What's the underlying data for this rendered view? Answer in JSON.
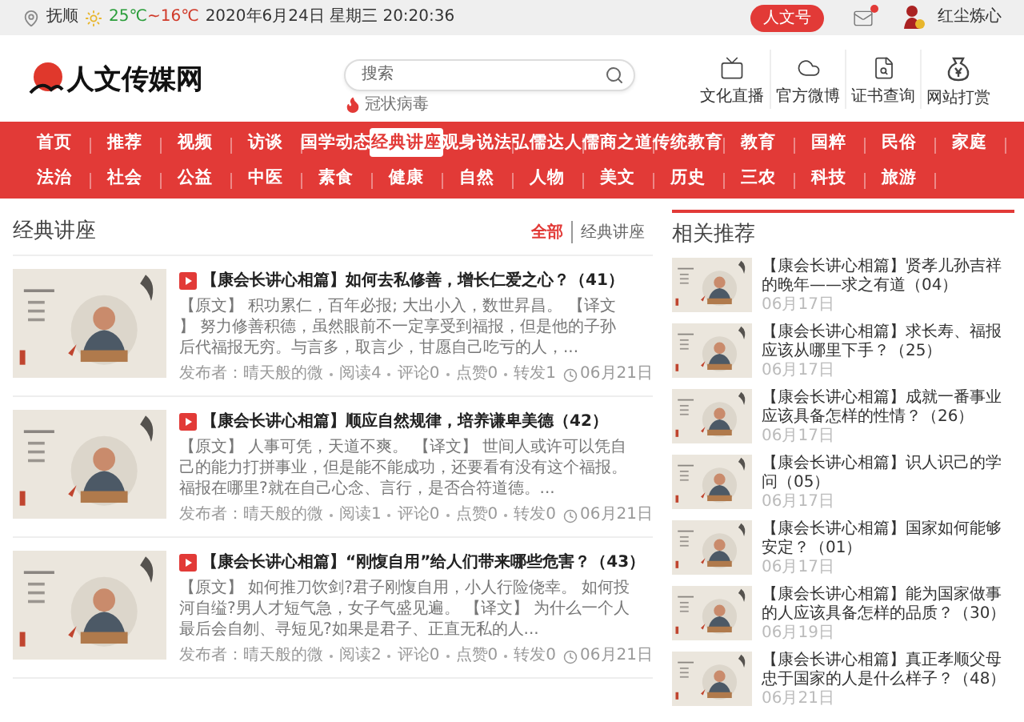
{
  "top_bar": {
    "city": "抚顺",
    "temp_high": "25℃",
    "temp_low": "~16℃",
    "datetime": "2020年6月24日 星期三 20:20:36",
    "account_button": "人文号",
    "mail": {
      "unread": true
    },
    "username": "红尘炼心"
  },
  "header": {
    "logo_text": "人文传媒网",
    "search": {
      "placeholder": "搜索"
    },
    "hot_tag": "冠状病毒",
    "shortcuts": [
      {
        "kind": "live",
        "label": "文化直播"
      },
      {
        "kind": "weibo",
        "label": "官方微博"
      },
      {
        "kind": "certificate",
        "label": "证书查询"
      },
      {
        "kind": "reward",
        "label": "网站打赏"
      }
    ]
  },
  "nav": {
    "rows": [
      [
        {
          "label": "首页",
          "selected": false
        },
        {
          "label": "推荐",
          "selected": false
        },
        {
          "label": "视频",
          "selected": false
        },
        {
          "label": "访谈",
          "selected": false
        },
        {
          "label": "国学动态",
          "selected": false
        },
        {
          "label": "经典讲座",
          "selected": true
        },
        {
          "label": "观身说法",
          "selected": false
        },
        {
          "label": "弘儒达人",
          "selected": false
        },
        {
          "label": "儒商之道",
          "selected": false
        },
        {
          "label": "传统教育",
          "selected": false
        },
        {
          "label": "教育",
          "selected": false
        },
        {
          "label": "国粹",
          "selected": false
        },
        {
          "label": "民俗",
          "selected": false
        },
        {
          "label": "家庭",
          "selected": false
        }
      ],
      [
        {
          "label": "法治",
          "selected": false
        },
        {
          "label": "社会",
          "selected": false
        },
        {
          "label": "公益",
          "selected": false
        },
        {
          "label": "中医",
          "selected": false
        },
        {
          "label": "素食",
          "selected": false
        },
        {
          "label": "健康",
          "selected": false
        },
        {
          "label": "自然",
          "selected": false
        },
        {
          "label": "人物",
          "selected": false
        },
        {
          "label": "美文",
          "selected": false
        },
        {
          "label": "历史",
          "selected": false
        },
        {
          "label": "三农",
          "selected": false
        },
        {
          "label": "科技",
          "selected": false
        },
        {
          "label": "旅游",
          "selected": false
        }
      ]
    ]
  },
  "section": {
    "title": "经典讲座",
    "filters": [
      {
        "label": "全部",
        "selected": true
      },
      {
        "label": "经典讲座",
        "selected": false
      }
    ]
  },
  "articles": [
    {
      "title": "【康会长讲心相篇】如何去私修善，增长仁爱之心？（41）",
      "excerpt": "【原文】 积功累仁，百年必报; 大出小入，数世昇昌。 【译文】 努力修善积德，虽然眼前不一定享受到福报，但是他的子孙后代福报无穷。与言多，取言少，甘愿自己吃亏的人，...",
      "publisher": "发布者：晴天般的微",
      "stats": [
        "阅读4",
        "评论0",
        "点赞0",
        "转发1"
      ],
      "date": "06月21日"
    },
    {
      "title": "【康会长讲心相篇】顺应自然规律，培养谦卑美德（42）",
      "excerpt": "【原文】 人事可凭，天道不爽。 【译文】 世间人或许可以凭自己的能力打拼事业，但是能不能成功，还要看有没有这个福报。福报在哪里?就在自己心念、言行，是否合符道德。...",
      "publisher": "发布者：晴天般的微",
      "stats": [
        "阅读1",
        "评论0",
        "点赞0",
        "转发0"
      ],
      "date": "06月21日"
    },
    {
      "title": "【康会长讲心相篇】“刚愎自用”给人们带来哪些危害？（43）",
      "excerpt": "【原文】 如何推刀饮剑?君子刚愎自用，小人行险侥幸。 如何投河自缢?男人才短气急，女子气盛见遍。 【译文】 为什么一个人最后会自刎、寻短见?如果是君子、正直无私的人...",
      "publisher": "发布者：晴天般的微",
      "stats": [
        "阅读2",
        "评论0",
        "点赞0",
        "转发0"
      ],
      "date": "06月21日"
    }
  ],
  "related": {
    "title": "相关推荐",
    "items": [
      {
        "title": "【康会长讲心相篇】贤孝儿孙吉祥的晚年——求之有道（04）",
        "date": "06月17日"
      },
      {
        "title": "【康会长讲心相篇】求长寿、福报应该从哪里下手？（25）",
        "date": "06月17日"
      },
      {
        "title": "【康会长讲心相篇】成就一番事业应该具备怎样的性情？（26）",
        "date": "06月17日"
      },
      {
        "title": "【康会长讲心相篇】识人识己的学问（05）",
        "date": "06月17日"
      },
      {
        "title": "【康会长讲心相篇】国家如何能够安定？（01）",
        "date": "06月17日"
      },
      {
        "title": "【康会长讲心相篇】能为国家做事的人应该具备怎样的品质？（30）",
        "date": "06月19日"
      },
      {
        "title": "【康会长讲心相篇】真正孝顺父母忠于国家的人是什么样子？（48）",
        "date": "06月21日"
      }
    ]
  }
}
